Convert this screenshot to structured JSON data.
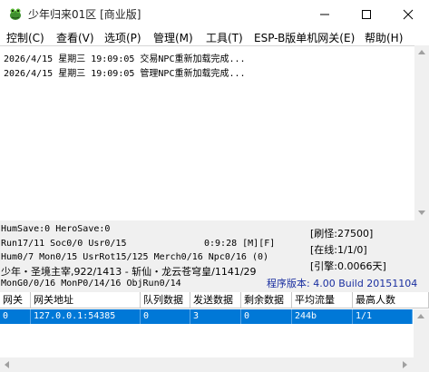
{
  "window": {
    "title": "少年归来01区 [商业版]",
    "icon": "frog-app-icon"
  },
  "menu": [
    "控制(C)",
    "查看(V)",
    "选项(P)",
    "管理(M)",
    "工具(T)",
    "ESP-B版单机网关(E)",
    "帮助(H)"
  ],
  "log": [
    "2026/4/15 星期三 19:09:05 交易NPC重新加载完成...",
    "2026/4/15 星期三 19:09:05 管理NPC重新加载完成..."
  ],
  "status": {
    "line1": "HumSave:0 HeroSave:0",
    "line2": "Run17/11 Soc0/0 Usr0/15",
    "time": "0:9:28 [M][F]",
    "line3": "Hum0/7 Mon0/15 UsrRot15/125 Merch0/16 Npc0/16 (0)",
    "line4": "少年・圣境主宰,922/1413 - 斩仙・龙云苍穹皇/1141/29",
    "line5": "MonG0/0/16 MonP0/14/16 ObjRun0/14",
    "refresh": "[刷怪:27500]",
    "online": "[在线:1/1/0]",
    "engine": "[引擎:0.0066天]",
    "version": "程序版本: 4.00 Build 20151104"
  },
  "table": {
    "columns": [
      "网关",
      "网关地址",
      "队列数据",
      "发送数据",
      "剩余数据",
      "平均流量",
      "最高人数"
    ],
    "rows": [
      [
        "0",
        "127.0.0.1:54385",
        "0",
        "3",
        "0",
        "244b",
        "1/1"
      ]
    ]
  },
  "colors": {
    "selection": "#0078d7",
    "version_text": "#1a2fa0"
  }
}
